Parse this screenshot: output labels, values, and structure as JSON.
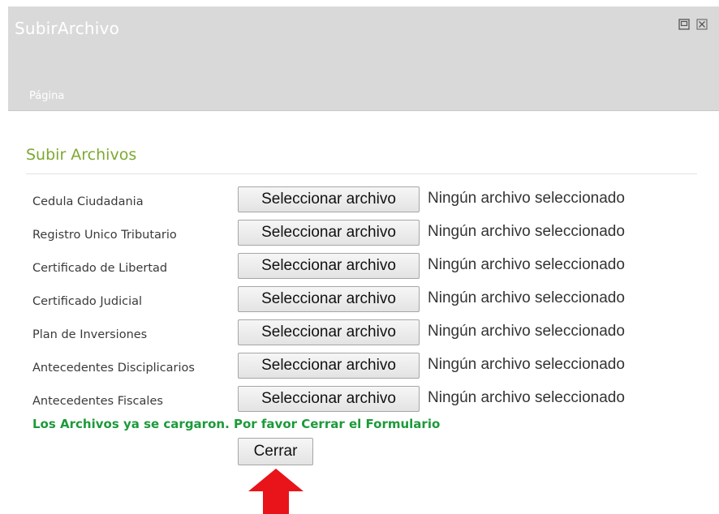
{
  "window": {
    "title": "SubirArchivo",
    "breadcrumb": "Página"
  },
  "section": {
    "title": "Subir Archivos"
  },
  "upload_rows": [
    {
      "label": "Cedula Ciudadania",
      "button": "Seleccionar archivo",
      "status": "Ningún archivo seleccionado"
    },
    {
      "label": "Registro Unico Tributario",
      "button": "Seleccionar archivo",
      "status": "Ningún archivo seleccionado"
    },
    {
      "label": "Certificado de Libertad",
      "button": "Seleccionar archivo",
      "status": "Ningún archivo seleccionado"
    },
    {
      "label": "Certificado Judicial",
      "button": "Seleccionar archivo",
      "status": "Ningún archivo seleccionado"
    },
    {
      "label": "Plan de Inversiones",
      "button": "Seleccionar archivo",
      "status": "Ningún archivo seleccionado"
    },
    {
      "label": "Antecedentes Disciplicarios",
      "button": "Seleccionar archivo",
      "status": "Ningún archivo seleccionado"
    },
    {
      "label": "Antecedentes Fiscales",
      "button": "Seleccionar archivo",
      "status": "Ningún archivo seleccionado"
    }
  ],
  "message": "Los Archivos ya se cargaron. Por favor Cerrar el Formulario",
  "close_button": "Cerrar",
  "icons": {
    "maximize": "maximize-icon",
    "close": "close-icon",
    "annotation": "red-arrow-up-icon"
  },
  "colors": {
    "header_bg": "#d9d9d9",
    "section_title": "#7ea832",
    "success_text": "#1c9a3a",
    "arrow": "#e8141a"
  }
}
